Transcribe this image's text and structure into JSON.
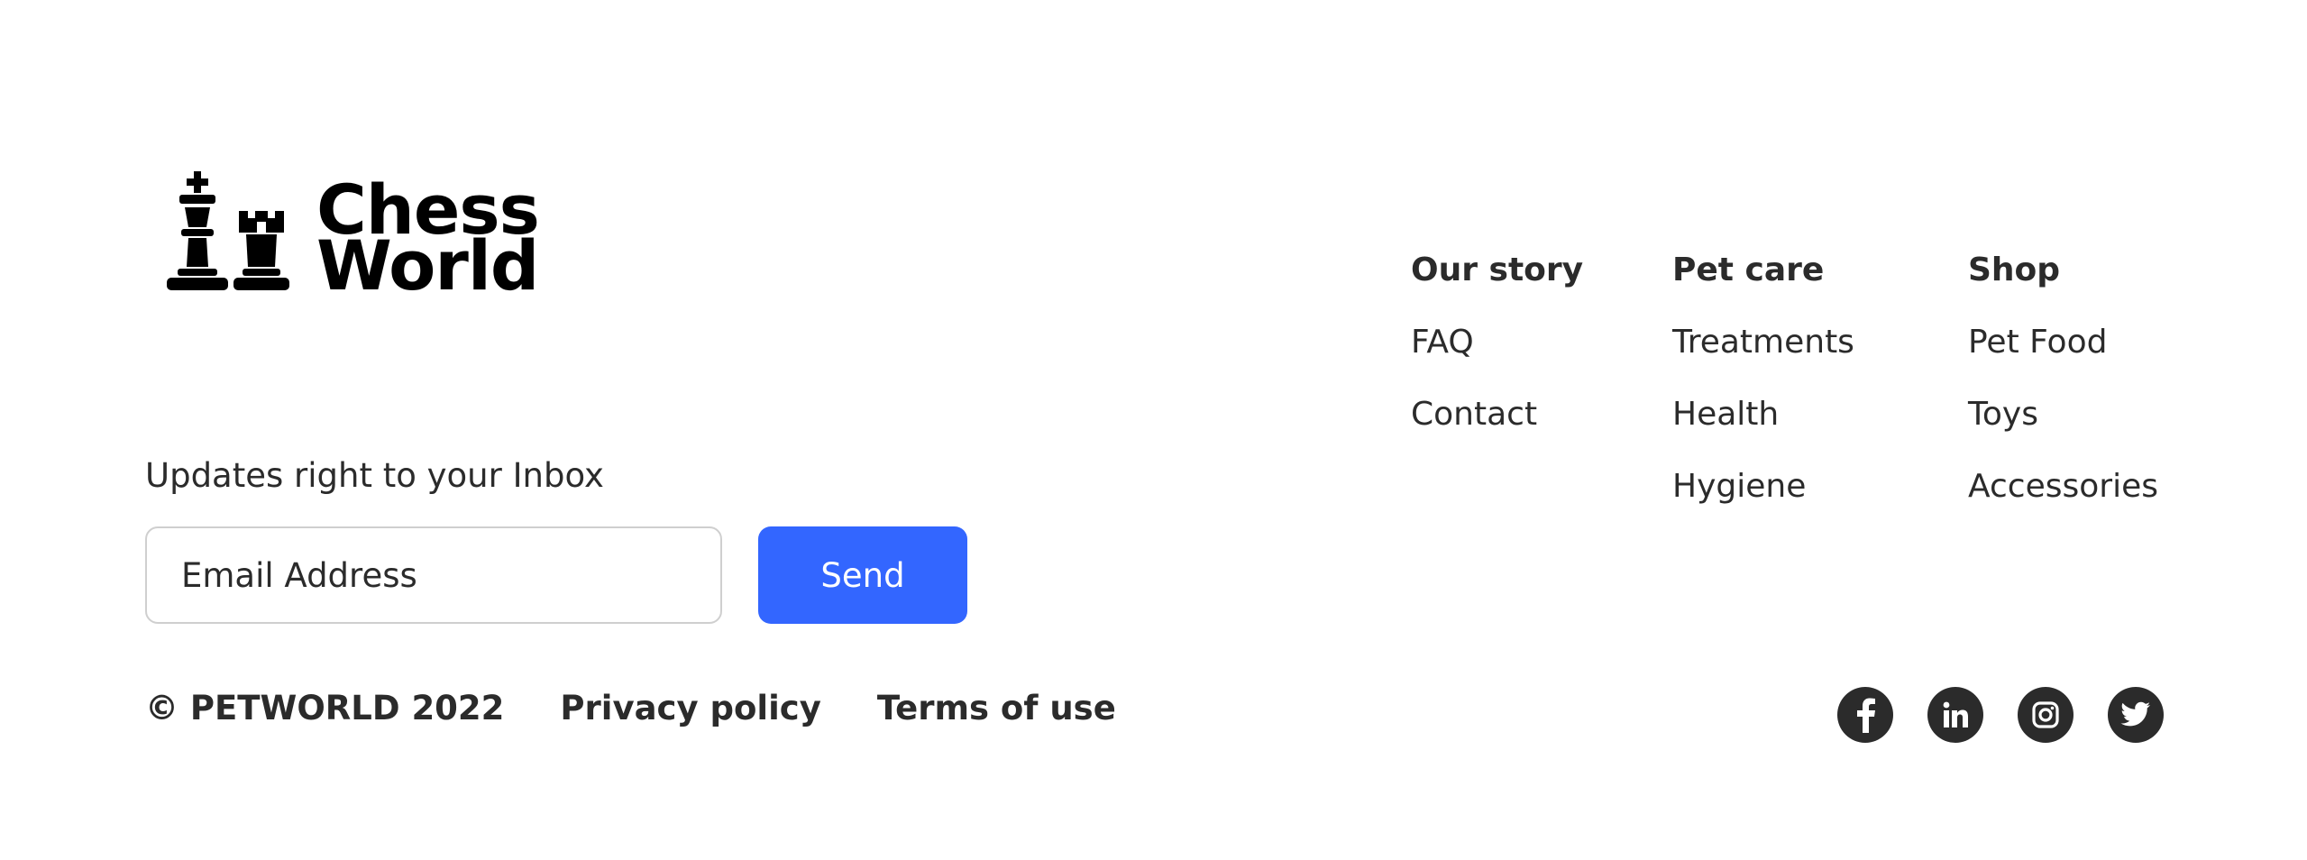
{
  "brand": {
    "name_line1": "Chess",
    "name_line2": "World"
  },
  "newsletter": {
    "label": "Updates right to your Inbox",
    "email_placeholder": "Email Address",
    "send_label": "Send"
  },
  "footer_bottom": {
    "copyright": "© PETWORLD 2022",
    "privacy_label": "Privacy policy",
    "terms_label": "Terms of use"
  },
  "nav_columns": [
    {
      "title": "Our story",
      "links": [
        "FAQ",
        "Contact"
      ]
    },
    {
      "title": "Pet care",
      "links": [
        "Treatments",
        "Health",
        "Hygiene"
      ]
    },
    {
      "title": "Shop",
      "links": [
        "Pet Food",
        "Toys",
        "Accessories"
      ]
    }
  ],
  "social": [
    {
      "name": "facebook",
      "icon": "facebook-icon"
    },
    {
      "name": "linkedin",
      "icon": "linkedin-icon"
    },
    {
      "name": "instagram",
      "icon": "instagram-icon"
    },
    {
      "name": "twitter",
      "icon": "twitter-icon"
    }
  ],
  "colors": {
    "accent": "#3366ff",
    "text": "#2b2b2b",
    "logo": "#000000",
    "input_border": "#cfcfcf"
  }
}
